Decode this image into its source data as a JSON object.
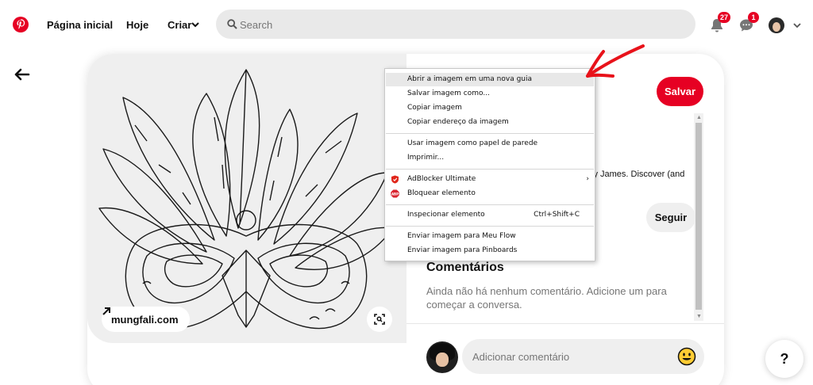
{
  "nav": {
    "home": "Página inicial",
    "today": "Hoje",
    "create": "Criar",
    "search_placeholder": "Search",
    "notifications_count": "27",
    "messages_count": "1"
  },
  "pin": {
    "domain": "mungfali.com",
    "save_label": "Salvar",
    "description_fragment": "erry James. Discover (and",
    "follow_label": "Seguir",
    "comments_title": "Comentários",
    "comments_empty": "Ainda não há nenhum comentário. Adicione um para começar a conversa.",
    "comment_placeholder": "Adicionar comentário"
  },
  "context_menu": {
    "items": [
      {
        "label": "Abrir a imagem em uma nova guia"
      },
      {
        "label": "Salvar imagem como..."
      },
      {
        "label": "Copiar imagem"
      },
      {
        "label": "Copiar endereço da imagem"
      },
      {
        "label": "Usar imagem como papel de parede"
      },
      {
        "label": "Imprimir..."
      },
      {
        "label": "AdBlocker Ultimate"
      },
      {
        "label": "Bloquear elemento"
      },
      {
        "label": "Inspecionar elemento",
        "shortcut": "Ctrl+Shift+C"
      },
      {
        "label": "Enviar imagem para Meu Flow"
      },
      {
        "label": "Enviar imagem para Pinboards"
      }
    ]
  },
  "help_label": "?",
  "colors": {
    "brand_red": "#e60023",
    "annotation_red": "#e8121a",
    "search_bg": "#e9e9e9"
  }
}
